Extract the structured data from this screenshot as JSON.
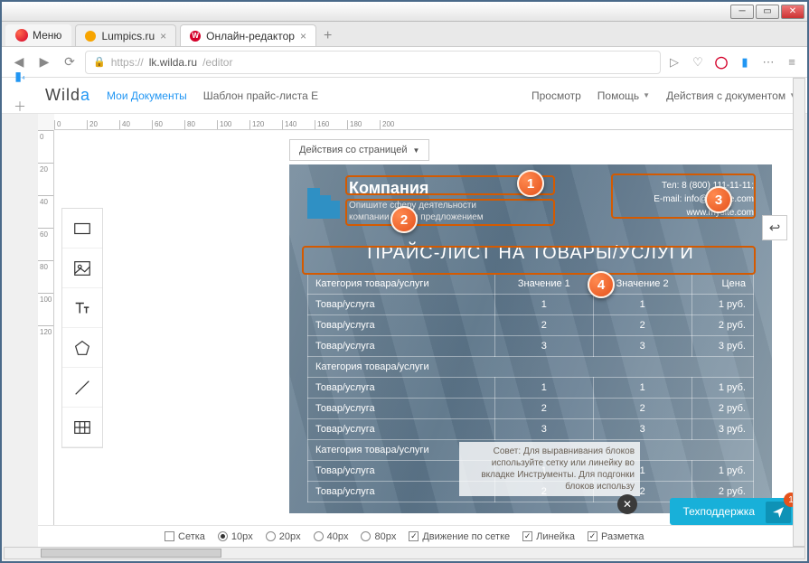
{
  "window": {
    "menu_label": "Меню"
  },
  "tabs": [
    {
      "title": "Lumpics.ru"
    },
    {
      "title": "Онлайн-редактор"
    }
  ],
  "address": {
    "prefix": "https://",
    "host": "lk.wilda.ru",
    "path": "/editor"
  },
  "app_header": {
    "logo_main": "Wild",
    "logo_accent": "a",
    "my_docs": "Мои Документы",
    "template": "Шаблон прайс-листа E",
    "preview": "Просмотр",
    "help": "Помощь",
    "doc_actions": "Действия с документом"
  },
  "page_actions": {
    "label": "Действия со страницей"
  },
  "ruler_h": [
    "0",
    "20",
    "40",
    "60",
    "80",
    "100",
    "120",
    "140",
    "160",
    "180",
    "200"
  ],
  "ruler_v": [
    "0",
    "20",
    "40",
    "60",
    "80",
    "100",
    "120"
  ],
  "doc": {
    "company_name": "Компания",
    "company_desc_l1": "Опишите сферу деятельности",
    "company_desc_l2": "компании одним предложением",
    "contacts": {
      "tel": "Тел: 8 (800) 111-11-11;",
      "email": "E-mail: info@mysite.com",
      "site": "www.mysite.com"
    },
    "title": "ПРАЙС-ЛИСТ НА ТОВАРЫ/УСЛУГИ",
    "headers": {
      "cat": "Категория товара/услуги",
      "v1": "Значение 1",
      "v2": "Значение 2",
      "price": "Цена"
    },
    "groups": [
      {
        "cat": "Категория товара/услуги",
        "rows": [
          {
            "name": "Товар/услуга",
            "v1": "1",
            "v2": "1",
            "price": "1 руб."
          },
          {
            "name": "Товар/услуга",
            "v1": "2",
            "v2": "2",
            "price": "2 руб."
          },
          {
            "name": "Товар/услуга",
            "v1": "3",
            "v2": "3",
            "price": "3 руб."
          }
        ]
      },
      {
        "cat": "Категория товара/услуги",
        "rows": [
          {
            "name": "Товар/услуга",
            "v1": "1",
            "v2": "1",
            "price": "1 руб."
          },
          {
            "name": "Товар/услуга",
            "v1": "2",
            "v2": "2",
            "price": "2 руб."
          },
          {
            "name": "Товар/услуга",
            "v1": "3",
            "v2": "3",
            "price": "3 руб."
          }
        ]
      },
      {
        "cat": "Категория товара/услуги",
        "rows": [
          {
            "name": "Товар/услуга",
            "v1": "1",
            "v2": "1",
            "price": "1 руб."
          },
          {
            "name": "Товар/услуга",
            "v1": "2",
            "v2": "2",
            "price": "2 руб."
          }
        ]
      }
    ]
  },
  "callouts": {
    "c1": "1",
    "c2": "2",
    "c3": "3",
    "c4": "4"
  },
  "hint": {
    "text": "Совет: Для выравнивания блоков используйте сетку или линейку во вкладке Инструменты. Для подгонки блоков использу"
  },
  "support": {
    "label": "Техподдержка",
    "badge": "1"
  },
  "bottom": {
    "grid": "Сетка",
    "p10": "10px",
    "p20": "20px",
    "p40": "40px",
    "p80": "80px",
    "snap": "Движение по сетке",
    "ruler": "Линейка",
    "markup": "Разметка"
  }
}
